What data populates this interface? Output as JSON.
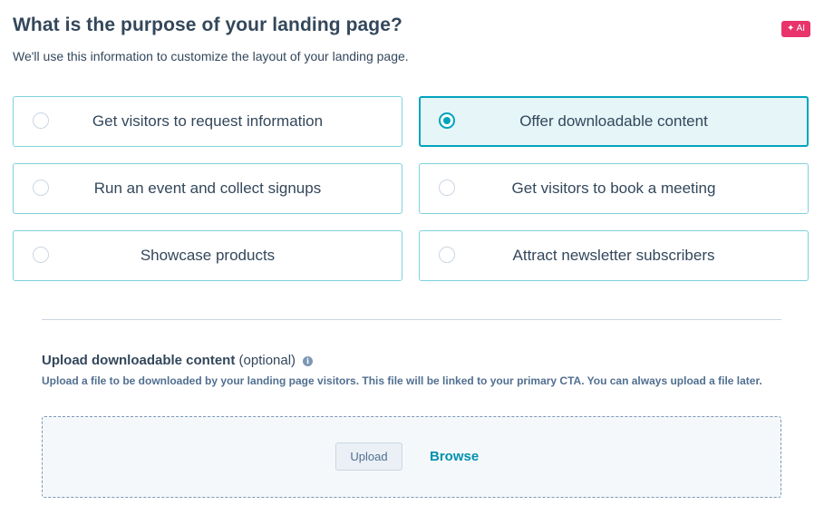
{
  "header": {
    "title": "What is the purpose of your landing page?",
    "ai_badge": "✦ AI",
    "subtitle": "We'll use this information to customize the layout of your landing page."
  },
  "options": [
    {
      "label": "Get visitors to request information",
      "selected": false
    },
    {
      "label": "Offer downloadable content",
      "selected": true
    },
    {
      "label": "Run an event and collect signups",
      "selected": false
    },
    {
      "label": "Get visitors to book a meeting",
      "selected": false
    },
    {
      "label": "Showcase products",
      "selected": false
    },
    {
      "label": "Attract newsletter subscribers",
      "selected": false
    }
  ],
  "upload": {
    "heading": "Upload downloadable content",
    "optional": " (optional)",
    "info_icon": "info-icon",
    "description": "Upload a file to be downloaded by your landing page visitors. This file will be linked to your primary CTA. You can always upload a file later.",
    "upload_button": "Upload",
    "browse_link": "Browse"
  },
  "colors": {
    "accent": "#00a4bd",
    "selected_bg": "#e5f5f8",
    "ai_badge": "#e8336b",
    "link": "#0091ae"
  }
}
